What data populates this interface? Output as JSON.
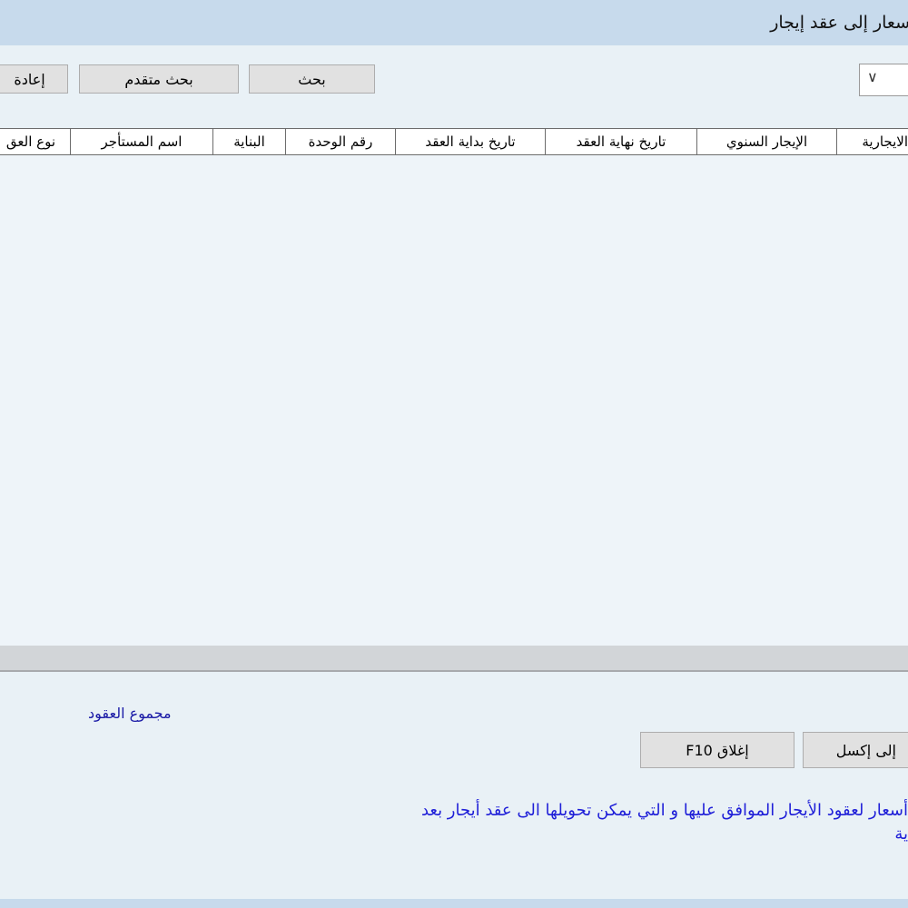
{
  "window": {
    "title": "سعار إلى عقد إيجار"
  },
  "toolbar": {
    "reset_label": "إعادة",
    "advanced_search_label": "بحث متقدم",
    "search_label": "بحث",
    "dropdown_value": ""
  },
  "grid": {
    "columns": [
      "نوع العق",
      "اسم المستأجر",
      "البناية",
      "رقم الوحدة",
      "تاريخ بداية العقد",
      "تاريخ نهاية العقد",
      "الإيجار السنوي",
      "الايجارية"
    ],
    "rows": []
  },
  "footer": {
    "total_label": "مجموع العقود",
    "close_label": "إغلاق F10",
    "export_label": "إلى إكسل",
    "note_line1": "أسعار لعقود الأيجار الموافق عليها و التي يمكن تحويلها الى عقد أيجار بعد",
    "note_line2": "ية"
  }
}
